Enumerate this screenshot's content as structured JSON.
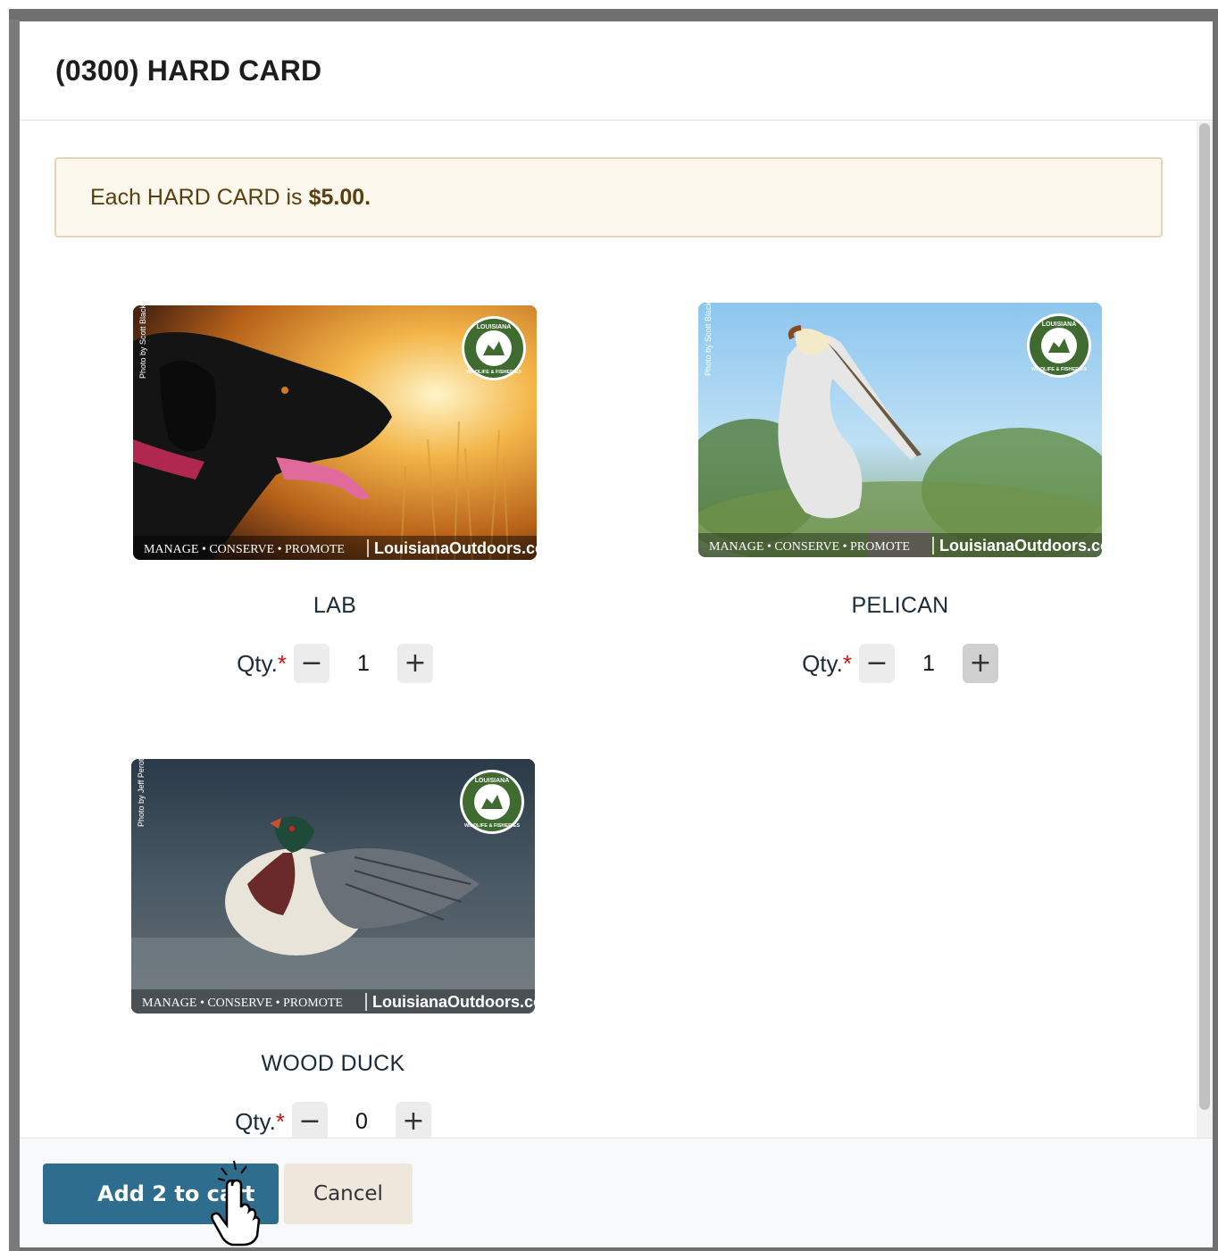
{
  "modal": {
    "title": "(0300) HARD CARD",
    "price_notice": {
      "text": "Each HARD CARD is",
      "price": "$5.00."
    }
  },
  "cards": [
    {
      "name": "LAB",
      "qty_label": "Qty.",
      "required_mark": "*",
      "quantity": "1",
      "photo_credit": "Photo by Scott Black",
      "tagline": "MANAGE • CONSERVE • PROMOTE",
      "site": "LouisianaOutdoors.com",
      "decrement": "−",
      "increment": "+"
    },
    {
      "name": "PELICAN",
      "qty_label": "Qty.",
      "required_mark": "*",
      "quantity": "1",
      "photo_credit": "Photo by Scott Black",
      "tagline": "MANAGE • CONSERVE • PROMOTE",
      "site": "LouisianaOutdoors.com",
      "decrement": "−",
      "increment": "+"
    },
    {
      "name": "WOOD DUCK",
      "qty_label": "Qty.",
      "required_mark": "*",
      "quantity": "0",
      "photo_credit": "Photo by Jeff Perot",
      "tagline": "MANAGE • CONSERVE • PROMOTE",
      "site": "LouisianaOutdoors.com",
      "decrement": "−",
      "increment": "+"
    }
  ],
  "logo_text": {
    "top": "LOUISIANA",
    "bottom": "WILDLIFE & FISHERIES"
  },
  "footer": {
    "add_button": "Add 2 to cart",
    "cancel_button": "Cancel"
  },
  "colors": {
    "primary_button": "#2e6d8d",
    "cancel_button": "#efe6dc",
    "alert_bg": "#fcf8ee",
    "required": "#d01010"
  }
}
